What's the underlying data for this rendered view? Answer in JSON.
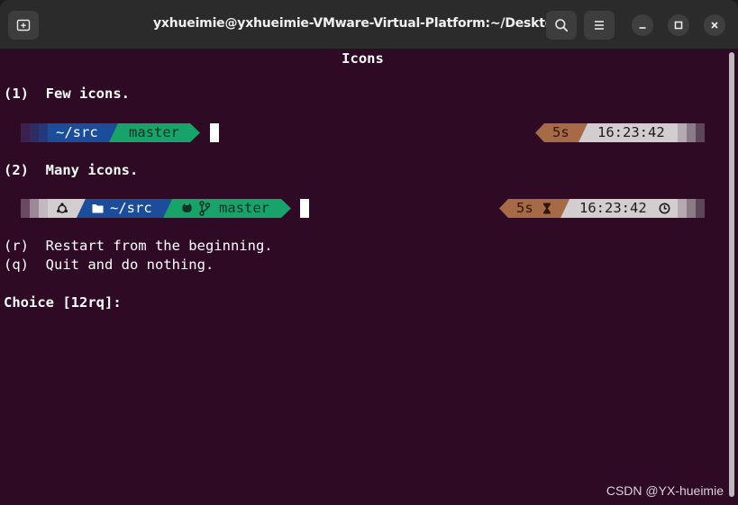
{
  "window": {
    "title": "yxhueimie@yxhueimie-VMware-Virtual-Platform:~/Desktop",
    "buttons": {
      "new_tab_icon": "new-tab-icon",
      "search_icon": "search-icon",
      "menu_icon": "hamburger-menu-icon",
      "minimize_icon": "minimize-icon",
      "maximize_icon": "maximize-icon",
      "close_icon": "close-icon"
    }
  },
  "terminal": {
    "heading": "Icons",
    "option1": "(1)  Few icons.",
    "option2": "(2)  Many icons.",
    "option_r": "(r)  Restart from the beginning.",
    "option_q": "(q)  Quit and do nothing.",
    "choice_prompt": "Choice [12rq]:",
    "prompt1": {
      "dir": "~/src",
      "branch": "master",
      "duration": "5s",
      "time": "16:23:42"
    },
    "prompt2": {
      "dir": "~/src",
      "branch": "master",
      "duration": "5s",
      "time": "16:23:42"
    }
  },
  "colors": {
    "background": "#2f0a24",
    "dir_segment": "#1c4d9a",
    "branch_segment": "#18a36b",
    "duration_segment": "#a66b46",
    "time_segment": "#d2cdcf"
  },
  "watermark": "CSDN @YX-hueimie"
}
